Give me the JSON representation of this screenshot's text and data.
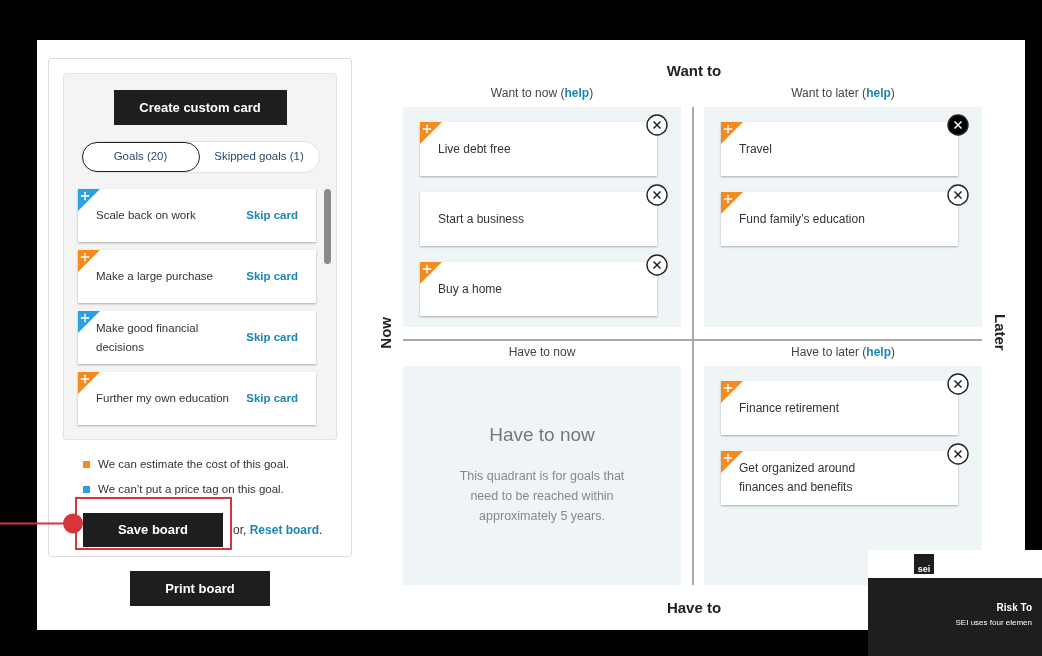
{
  "sidebar": {
    "create_button": "Create custom card",
    "tabs": [
      {
        "label": "Goals (20)",
        "selected": true
      },
      {
        "label": "Skipped goals (1)",
        "selected": false
      }
    ],
    "cards": [
      {
        "title": "Scale back on work",
        "kind": "priceless",
        "skip": "Skip card"
      },
      {
        "title": "Make a large purchase",
        "kind": "estimate",
        "skip": "Skip card"
      },
      {
        "title": "Make good financial decisions",
        "kind": "priceless",
        "skip": "Skip card"
      },
      {
        "title": "Further my own education",
        "kind": "estimate",
        "skip": "Skip card"
      }
    ],
    "legend": [
      {
        "kind": "estimate",
        "text": "We can estimate the cost of this goal."
      },
      {
        "kind": "priceless",
        "text": "We can’t put a price tag on this goal."
      }
    ],
    "save_button": "Save board",
    "reset_before": "or,",
    "reset_link": "Reset board",
    "reset_after": "."
  },
  "print_button": "Print board",
  "board": {
    "top_label": "Want to",
    "bottom_label": "Have to",
    "left_label": "Now",
    "right_label": "Later",
    "quadrants": [
      {
        "title": "Want to now (",
        "link": "help",
        "after": ")",
        "cards": [
          {
            "title": "Live debt free",
            "kind": "estimate",
            "active": false
          },
          {
            "title": "Start a business",
            "kind": "plain",
            "active": false
          },
          {
            "title": "Buy a home",
            "kind": "estimate",
            "active": false
          }
        ]
      },
      {
        "title": "Want to later (",
        "link": "help",
        "after": ")",
        "cards": [
          {
            "title": "Travel",
            "kind": "estimate",
            "active": true
          },
          {
            "title": "Fund family’s education",
            "kind": "estimate",
            "active": false
          }
        ]
      },
      {
        "title": "Have to now",
        "placeholder": {
          "heading": "Have to now",
          "text": "This quadrant is for goals that need to be reached within approximately 5 years."
        }
      },
      {
        "title": "Have to later (",
        "link": "help",
        "after": ")",
        "cards": [
          {
            "title": "Finance retirement",
            "kind": "estimate",
            "active": false
          },
          {
            "title": "Get organized around finances and benefits",
            "kind": "estimate",
            "active": false
          }
        ]
      }
    ]
  },
  "overlay": {
    "logo": "sei",
    "title": "Risk To",
    "subtitle": "SEI uses four elemen"
  }
}
